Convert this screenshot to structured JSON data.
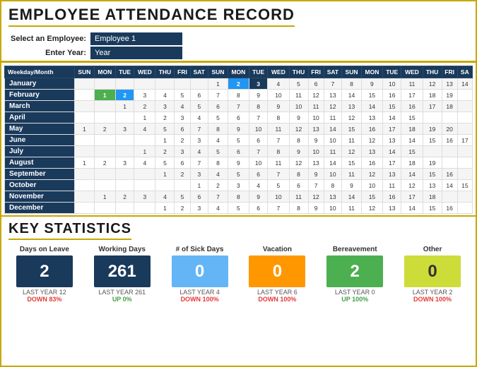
{
  "header": {
    "title": "EMPLOYEE ATTENDANCE RECORD",
    "employee_label": "Select an Employee:",
    "year_label": "Enter Year:",
    "employee_value": "Employee 1",
    "year_value": "Year"
  },
  "calendar": {
    "col_headers": [
      "Weekday/Month",
      "SUN",
      "MON",
      "TUE",
      "WED",
      "THU",
      "FRI",
      "SAT",
      "SUN",
      "MON",
      "TUE",
      "WED",
      "THU",
      "FRI",
      "SAT",
      "SUN",
      "MON",
      "TUE",
      "WED",
      "THU",
      "FRI",
      "SA"
    ],
    "months": [
      {
        "name": "January",
        "days": [
          null,
          null,
          null,
          null,
          null,
          null,
          null,
          1,
          2,
          3,
          4,
          5,
          6,
          7,
          8,
          9,
          10,
          11,
          12,
          13,
          14
        ]
      },
      {
        "name": "February",
        "days": [
          null,
          1,
          2,
          3,
          4,
          5,
          6,
          7,
          8,
          9,
          10,
          11,
          12,
          13,
          14,
          15,
          16,
          17,
          18,
          19
        ]
      },
      {
        "name": "March",
        "days": [
          null,
          null,
          1,
          2,
          3,
          4,
          5,
          6,
          7,
          8,
          9,
          10,
          11,
          12,
          13,
          14,
          15,
          16,
          17,
          18
        ]
      },
      {
        "name": "April",
        "days": [
          null,
          null,
          null,
          1,
          2,
          3,
          4,
          5,
          6,
          7,
          8,
          9,
          10,
          11,
          12,
          13,
          14,
          15
        ]
      },
      {
        "name": "May",
        "days": [
          1,
          2,
          3,
          4,
          5,
          6,
          7,
          8,
          9,
          10,
          11,
          12,
          13,
          14,
          15,
          16,
          17,
          18,
          19,
          20
        ]
      },
      {
        "name": "June",
        "days": [
          null,
          null,
          null,
          null,
          1,
          2,
          3,
          4,
          5,
          6,
          7,
          8,
          9,
          10,
          11,
          12,
          13,
          14,
          15,
          16,
          17
        ]
      },
      {
        "name": "July",
        "days": [
          null,
          null,
          null,
          1,
          2,
          3,
          4,
          5,
          6,
          7,
          8,
          9,
          10,
          11,
          12,
          13,
          14,
          15
        ]
      },
      {
        "name": "August",
        "days": [
          1,
          2,
          3,
          4,
          5,
          6,
          7,
          8,
          9,
          10,
          11,
          12,
          13,
          14,
          15,
          16,
          17,
          18,
          19
        ]
      },
      {
        "name": "September",
        "days": [
          null,
          null,
          null,
          null,
          1,
          2,
          3,
          4,
          5,
          6,
          7,
          8,
          9,
          10,
          11,
          12,
          13,
          14,
          15,
          16
        ]
      },
      {
        "name": "October",
        "days": [
          null,
          null,
          null,
          null,
          null,
          null,
          1,
          2,
          3,
          4,
          5,
          6,
          7,
          8,
          9,
          10,
          11,
          12,
          13,
          14,
          15
        ]
      },
      {
        "name": "November",
        "days": [
          null,
          1,
          2,
          3,
          4,
          5,
          6,
          7,
          8,
          9,
          10,
          11,
          12,
          13,
          14,
          15,
          16,
          17,
          18
        ]
      },
      {
        "name": "December",
        "days": [
          null,
          null,
          null,
          null,
          1,
          2,
          3,
          4,
          5,
          6,
          7,
          8,
          9,
          10,
          11,
          12,
          13,
          14,
          15,
          16
        ]
      }
    ]
  },
  "statistics": {
    "title": "KEY STATISTICS",
    "cards": [
      {
        "label": "Days on Leave",
        "value": "2",
        "last_year": "LAST YEAR  12",
        "change": "DOWN 83%",
        "change_type": "down",
        "color": "navy"
      },
      {
        "label": "Working Days",
        "value": "261",
        "last_year": "LAST YEAR  261",
        "change": "UP 0%",
        "change_type": "up",
        "color": "navy"
      },
      {
        "label": "# of Sick Days",
        "value": "0",
        "last_year": "LAST YEAR  4",
        "change": "DOWN 100%",
        "change_type": "down",
        "color": "blue"
      },
      {
        "label": "Vacation",
        "value": "0",
        "last_year": "LAST YEAR  6",
        "change": "DOWN 100%",
        "change_type": "down",
        "color": "orange"
      },
      {
        "label": "Bereavement",
        "value": "2",
        "last_year": "LAST YEAR  0",
        "change": "UP 100%",
        "change_type": "up",
        "color": "green"
      },
      {
        "label": "Other",
        "value": "0",
        "last_year": "LAST YEAR  2",
        "change": "DOWN 100%",
        "change_type": "down",
        "color": "yellow"
      }
    ]
  }
}
